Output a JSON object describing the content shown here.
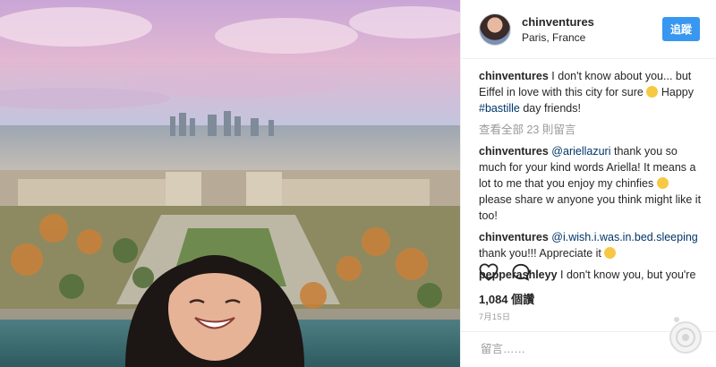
{
  "post": {
    "username": "chinventures",
    "location": "Paris, France",
    "follow_label": "追蹤"
  },
  "caption": {
    "user": "chinventures",
    "text_before": "I don't know about you... but Eiffel in love with this city for sure",
    "text_after": "Happy",
    "hashtag": "#bastille",
    "text_end": "day friends!",
    "emoji": "smiling-face-heart-eyes"
  },
  "view_all_comments": "查看全部 23 則留言",
  "comments": [
    {
      "user": "chinventures",
      "mention": "@ariellazuri",
      "text": "thank you so much for your kind words Ariella! It means a lot to me that you enjoy my chinfies",
      "text_after": "please share w anyone you think might like it too!",
      "emoji": "smiling-face"
    },
    {
      "user": "chinventures",
      "mention": "@i.wish.i.was.in.bed.sleeping",
      "text": "thank you!!! Appreciate it",
      "emoji": "hugging-face"
    },
    {
      "user": "pepperashleyy",
      "text": "I don't know you, but you're"
    }
  ],
  "likes": "1,084 個讚",
  "date": "7月15日",
  "comment_placeholder": "留言……",
  "icons": {
    "like": "heart-icon",
    "comment": "comment-bubble-icon"
  },
  "colors": {
    "link": "#003569",
    "follow_button": "#3897f0",
    "muted": "#999999"
  }
}
